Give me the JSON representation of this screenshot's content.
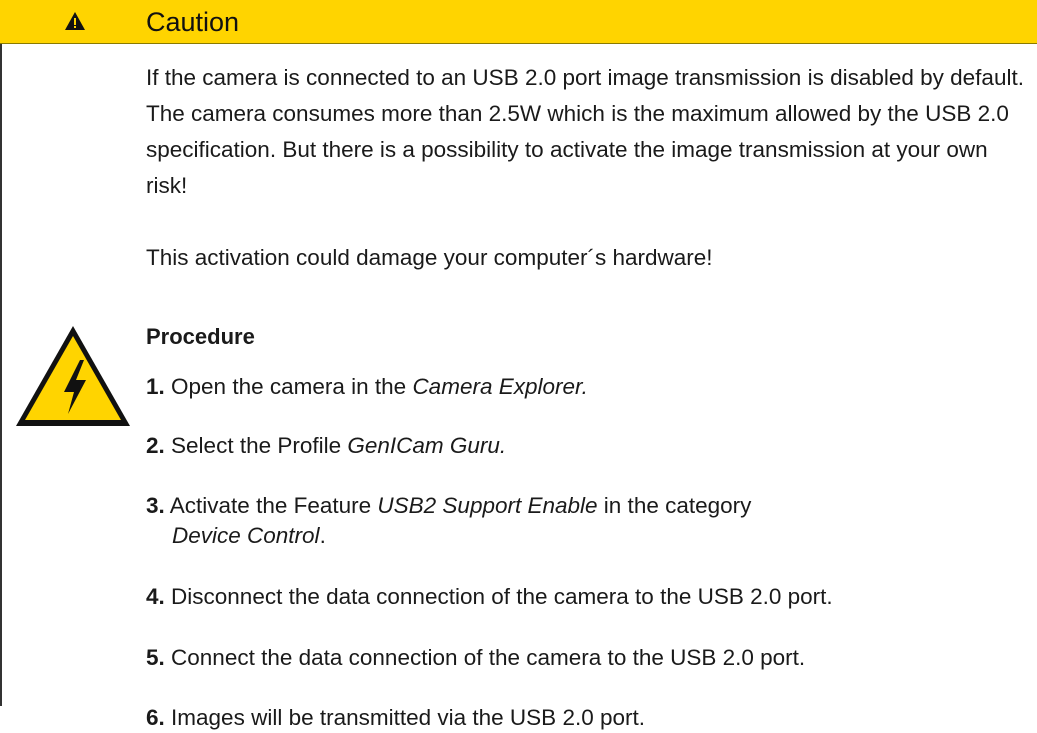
{
  "header": {
    "title": "Caution",
    "icon": "warning-triangle-icon",
    "background": "#ffd400"
  },
  "intro": {
    "paragraph": "If the camera is connected to an USB 2.0 port image transmission is disabled by default. The camera consumes more than 2.5W which is the maximum allowed by the USB 2.0 specification. But there is a possibility to activate the image transmission at your own risk!",
    "warning": "This activation could damage your computer´s hardware!"
  },
  "hazard_icon": "high-voltage-icon",
  "procedure": {
    "title": "Procedure",
    "steps": [
      {
        "num": "1.",
        "text": "Open the camera in the ",
        "em": "Camera Explorer.",
        "tail": ""
      },
      {
        "num": "2.",
        "text": "Select the Profile ",
        "em": "GenICam Guru.",
        "tail": ""
      },
      {
        "num": "3.",
        "text": "Activate the Feature ",
        "em": "USB2 Support Enable",
        "tail": " in the category",
        "em2": "Device Control",
        "tail2": "."
      },
      {
        "num": "4.",
        "text": "Disconnect the data connection of the camera to the USB 2.0 port.",
        "em": "",
        "tail": ""
      },
      {
        "num": "5.",
        "text": "Connect the data connection of the camera to the USB 2.0 port.",
        "em": "",
        "tail": ""
      },
      {
        "num": "6.",
        "text": "Images will be transmitted via the USB 2.0 port.",
        "em": "",
        "tail": ""
      }
    ]
  }
}
